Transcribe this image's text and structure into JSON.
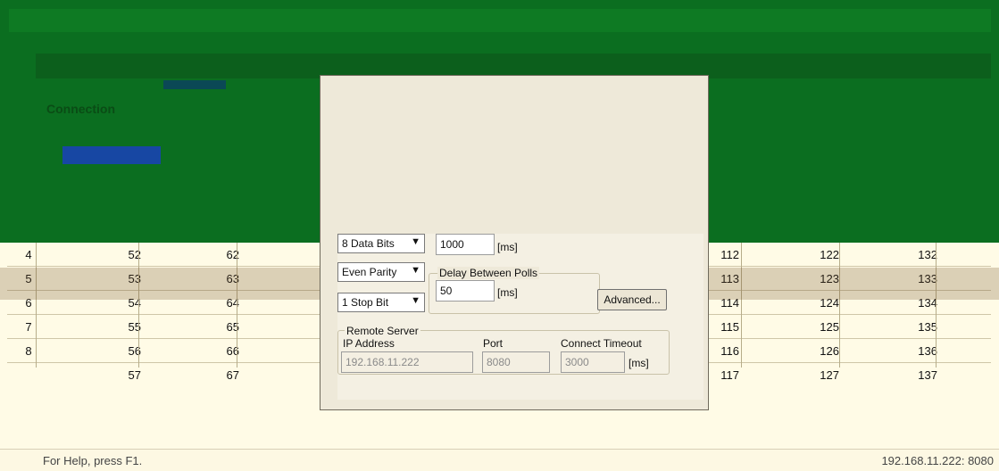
{
  "window": {
    "title": "",
    "side_title": "Connection"
  },
  "status": {
    "help": "For Help, press F1.",
    "connection": "192.168.11.222: 8080"
  },
  "grid": {
    "rows": [
      {
        "n": "4",
        "a": "52",
        "b": "62",
        "c": "112",
        "d": "122",
        "e": "132"
      },
      {
        "n": "5",
        "a": "53",
        "b": "63",
        "c": "113",
        "d": "123",
        "e": "133"
      },
      {
        "n": "6",
        "a": "54",
        "b": "64",
        "c": "114",
        "d": "124",
        "e": "134"
      },
      {
        "n": "7",
        "a": "55",
        "b": "65",
        "c": "115",
        "d": "125",
        "e": "135"
      },
      {
        "n": "8",
        "a": "56",
        "b": "66",
        "c": "116",
        "d": "126",
        "e": "136"
      },
      {
        "n": "",
        "a": "57",
        "b": "67",
        "c": "117",
        "d": "127",
        "e": "137"
      }
    ]
  },
  "dialog": {
    "data_bits": "8 Data Bits",
    "parity": "Even Parity",
    "stop_bits": "1 Stop Bit",
    "response_timeout": "1000",
    "ms1": "[ms]",
    "delay_label": "Delay Between Polls",
    "delay_value": "50",
    "ms2": "[ms]",
    "advanced_label": "Advanced...",
    "remote_server_label": "Remote Server",
    "ip_label": "IP Address",
    "ip_value": "192.168.11.222",
    "port_label": "Port",
    "port_value": "8080",
    "connect_timeout_label": "Connect Timeout",
    "connect_timeout_value": "3000",
    "ms3": "[ms]"
  },
  "colors": {
    "top_band": "#0b6e20",
    "background": "#fffbe6",
    "highlight": "#1747a3"
  }
}
